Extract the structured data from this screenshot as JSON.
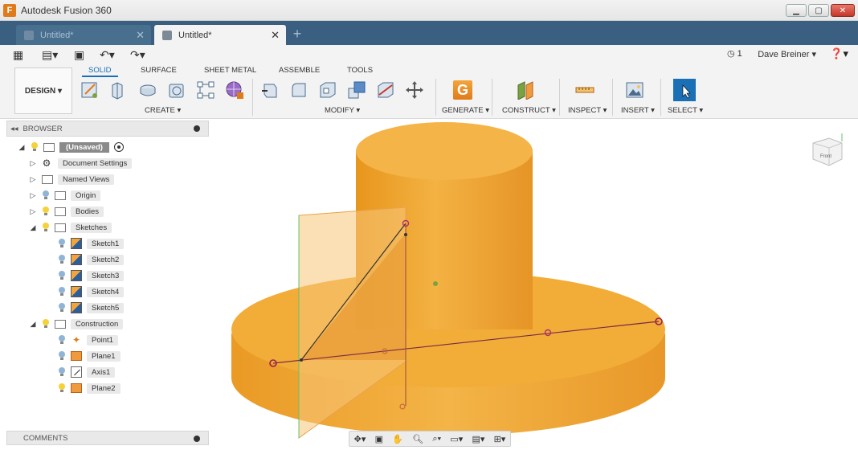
{
  "window": {
    "app_title": "Autodesk Fusion 360",
    "logo_letter": "F"
  },
  "doc_tabs": [
    {
      "label": "Untitled*",
      "active": false
    },
    {
      "label": "Untitled*",
      "active": true
    }
  ],
  "quickbar": {
    "user": "Dave Breiner ▾",
    "jobs": "1"
  },
  "ribbon": {
    "workspace": "DESIGN ▾",
    "tabs": [
      "SOLID",
      "SURFACE",
      "SHEET METAL",
      "ASSEMBLE",
      "TOOLS"
    ],
    "groups": [
      "CREATE ▾",
      "MODIFY ▾",
      "GENERATE ▾",
      "CONSTRUCT ▾",
      "INSPECT ▾",
      "INSERT ▾",
      "SELECT ▾"
    ],
    "generate_letter": "G"
  },
  "browser": {
    "title": "BROWSER",
    "root": "(Unsaved)",
    "items": [
      "Document Settings",
      "Named Views",
      "Origin",
      "Bodies",
      "Sketches",
      "Sketch1",
      "Sketch2",
      "Sketch3",
      "Sketch4",
      "Sketch5",
      "Construction",
      "Point1",
      "Plane1",
      "Axis1",
      "Plane2"
    ]
  },
  "comments": {
    "title": "COMMENTS"
  },
  "viewcube": {
    "face": "Front"
  },
  "colors": {
    "model": "#f0a630",
    "tab_bar": "#3a5f80",
    "accent": "#1a6fb5"
  }
}
